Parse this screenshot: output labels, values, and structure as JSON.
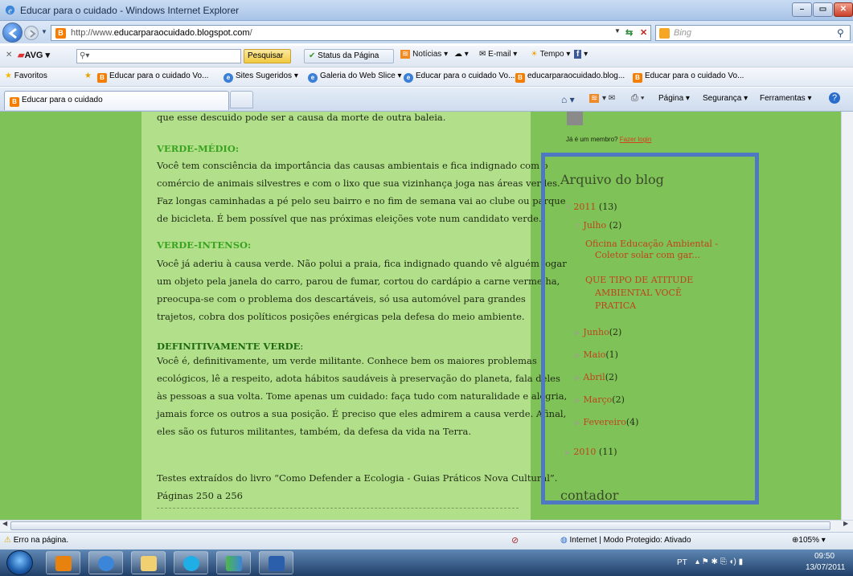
{
  "window": {
    "title": "Educar para o cuidado - Windows Internet Explorer",
    "min": "–",
    "max": "▭",
    "close": "✕"
  },
  "address": {
    "prefix": "http://www.",
    "domain": "educarparaocuidado.blogspot.com",
    "suffix": "/",
    "favicon": "B"
  },
  "search": {
    "placeholder": "Bing"
  },
  "avg": {
    "brand": "AVG",
    "search_btn": "Pesquisar",
    "status_btn": "Status da Página",
    "noticias": "Notícias",
    "email": "E-mail",
    "tempo": "Tempo"
  },
  "favorites": {
    "label": "Favoritos",
    "items": [
      "Educar para o cuidado Vo...",
      "Sites Sugeridos ▾",
      "Galeria do Web Slice ▾",
      "Educar para o cuidado Vo...",
      "educarparaocuidado.blog...",
      "Educar para o cuidado Vo..."
    ]
  },
  "tab": {
    "label": "Educar para o cuidado"
  },
  "commandbar": {
    "pagina": "Página ▾",
    "seguranca": "Segurança ▾",
    "ferramentas": "Ferramentas ▾"
  },
  "post": {
    "line0": "que esse descuido pode ser a causa da morte de outra baleia.",
    "h1": "VERDE-MÉDIO:",
    "p1": [
      "Você tem consciência da importância das causas ambientais e fica indignado com o",
      "comércio de animais silvestres e com o lixo que sua vizinhança joga nas áreas verdes.",
      "Faz longas caminhadas a pé pelo seu bairro e no fim de semana vai ao clube ou parque",
      "de bicicleta. É bem possível que nas próximas eleições vote num candidato verde."
    ],
    "h2": "VERDE-INTENSO:",
    "p2": [
      "Você já aderiu à causa verde. Não polui a praia, fica indignado quando vê alguém jogar",
      "um objeto pela janela do carro, parou de fumar, cortou do cardápio a carne vermelha,",
      "preocupa-se com o problema dos descartáveis, só usa automóvel para grandes",
      "trajetos, cobra dos políticos posições enérgicas pela defesa do meio ambiente."
    ],
    "h3a": "DEFINITIVAMENTE VERDE",
    "h3b": ":",
    "p3": [
      "Você é, definitivamente, um verde militante. Conhece bem os maiores problemas",
      "ecológicos, lê a respeito, adota hábitos saudáveis à preservação do planeta, fala deles",
      "às pessoas a sua volta. Tome apenas um cuidado: faça tudo com naturalidade e alegria,",
      "jamais force os outros a sua posição. É preciso que eles admirem a causa verde. Afinal,",
      "eles são os futuros militantes, também, da defesa da vida na Terra."
    ],
    "source": [
      "Testes extraídos do livro “Como Defender a Ecologia - Guias Práticos Nova Cultural”.",
      "Páginas 250 a 256"
    ]
  },
  "sidebar": {
    "member_text": "Já é um membro?",
    "login": "Fazer login",
    "archive_title": "Arquivo do blog",
    "y2011": "2011",
    "y2011_count": "(13)",
    "julho": "Julho",
    "julho_count": "(2)",
    "post1_l1": "Oficina Educação Ambiental -",
    "post1_l2": "Coletor solar com gar...",
    "post2_l1": "QUE TIPO DE ATITUDE",
    "post2_l2": "AMBIENTAL VOCÊ",
    "post2_l3": "PRATICA",
    "months": [
      {
        "name": "Junho",
        "count": "(2)"
      },
      {
        "name": "Maio",
        "count": "(1)"
      },
      {
        "name": "Abril",
        "count": "(2)"
      },
      {
        "name": "Março",
        "count": "(2)"
      },
      {
        "name": "Fevereiro",
        "count": "(4)"
      }
    ],
    "y2010": "2010",
    "y2010_count": "(11)",
    "contador": "contador"
  },
  "statusbar": {
    "left": "Erro na página.",
    "zone": "Internet | Modo Protegido: Ativado",
    "zoom": "105%"
  },
  "tray": {
    "lang": "PT",
    "time": "09:50",
    "date": "13/07/2011"
  },
  "colors": {
    "page_bg": "#7fc257",
    "post_bg": "#b2e08a",
    "link": "#c0431e",
    "heading": "#3aa31f",
    "archive_border": "#4f78c2"
  }
}
